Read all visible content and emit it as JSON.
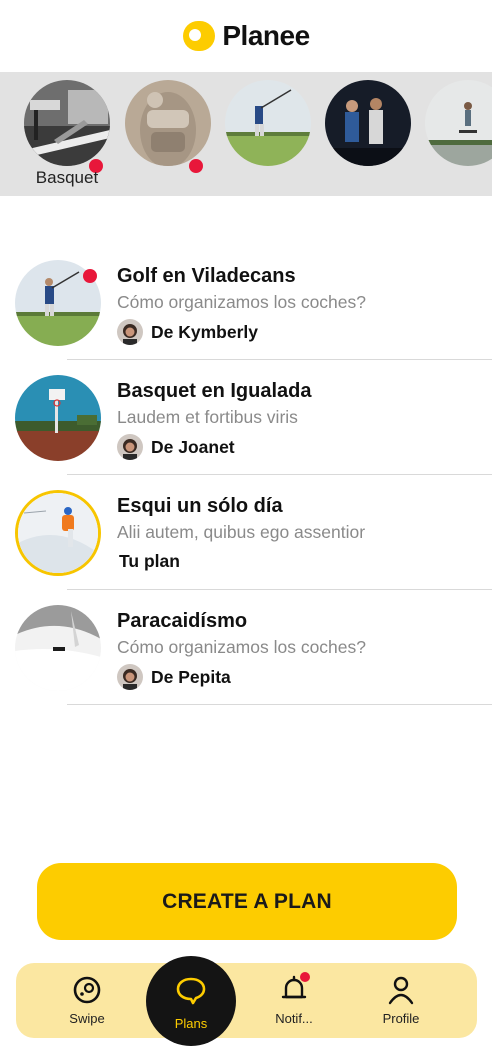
{
  "header": {
    "title": "Planee",
    "logo_icon": "planee-logo-icon"
  },
  "stories": {
    "items": [
      {
        "label": "Basquet",
        "unread": true,
        "image": "basketball-court-photo"
      },
      {
        "label": "",
        "unread": true,
        "image": "armor-photo"
      },
      {
        "label": "",
        "unread": false,
        "image": "golf-swing-photo"
      },
      {
        "label": "",
        "unread": false,
        "image": "people-night-photo"
      },
      {
        "label": "",
        "unread": false,
        "image": "skateboard-photo"
      }
    ]
  },
  "plans": [
    {
      "title": "Golf en Viladecans",
      "subtitle": "Cómo organizamos los coches?",
      "author": "De Kymberly",
      "unread": true,
      "own": false
    },
    {
      "title": "Basquet en Igualada",
      "subtitle": "Laudem et fortibus viris",
      "author": "De Joanet",
      "unread": false,
      "own": false
    },
    {
      "title": "Esqui un sólo día",
      "subtitle": "Alii autem, quibus ego assentior",
      "author": "Tu plan",
      "unread": false,
      "own": true
    },
    {
      "title": "Paracaidísmo",
      "subtitle": "Cómo organizamos los coches?",
      "author": "De Pepita",
      "unread": false,
      "own": false
    }
  ],
  "cta": {
    "label": "CREATE A PLAN"
  },
  "nav": {
    "swipe": "Swipe",
    "plans": "Plans",
    "notif": "Notif...",
    "profile": "Profile",
    "active": "plans"
  },
  "colors": {
    "accent": "#fdcc00",
    "badge": "#e8173a",
    "nav_bg": "#fbe7a1",
    "stories_bg": "#e2e2e2"
  }
}
